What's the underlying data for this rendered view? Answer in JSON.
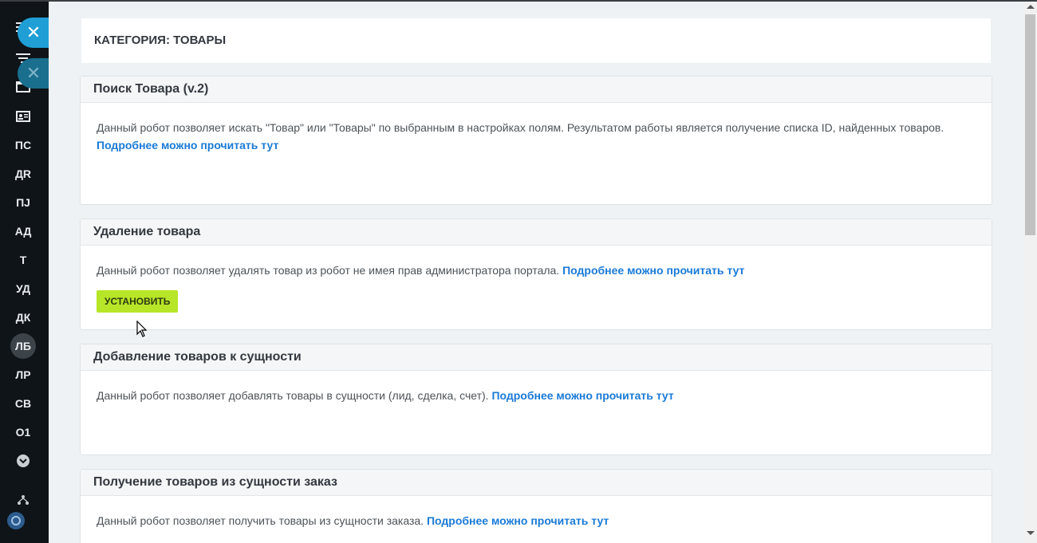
{
  "sidebar": {
    "items": [
      {
        "label": "ПС"
      },
      {
        "label": "ДR"
      },
      {
        "label": "ПJ"
      },
      {
        "label": "АД"
      },
      {
        "label": "Т"
      },
      {
        "label": "УД"
      },
      {
        "label": "ДК"
      },
      {
        "label": "ЛБ",
        "active": true
      },
      {
        "label": "ЛР"
      },
      {
        "label": "СВ"
      },
      {
        "label": "О1"
      }
    ],
    "close_glyph": "✕",
    "icons": [
      "menu-icon",
      "filter-icon",
      "calendar-icon",
      "contact-card-icon",
      "expand-down-icon",
      "org-structure-icon",
      "logo-icon"
    ],
    "colors": {
      "close_primary": "#1f9fd6",
      "close_secondary": "#1a6f8f"
    }
  },
  "category": {
    "title": "КАТЕГОРИЯ: ТОВАРЫ"
  },
  "cards": [
    {
      "title": "Поиск Товара (v.2)",
      "text": "Данный робот позволяет искать \"Товар\" или \"Товары\" по выбранным в настройках полям. Результатом работы является получение списка ID, найденных товаров.",
      "link": "Подробнее можно прочитать тут"
    },
    {
      "title": "Удаление товара",
      "text": "Данный робот позволяет удалять товар из робот не имея прав администратора портала.",
      "link": "Подробнее можно прочитать тут",
      "button": "УСТАНОВИТЬ"
    },
    {
      "title": "Добавление товаров к сущности",
      "text": "Данный робот позволяет добавлять товары в сущности (лид, сделка, счет).",
      "link": "Подробнее можно прочитать тут"
    },
    {
      "title": "Получение товаров из сущности заказ",
      "text": "Данный робот позволяет получить товары из сущности заказа.",
      "link": "Подробнее можно прочитать тут"
    }
  ],
  "colors": {
    "link": "#1a7ad6",
    "install_button": "#b7e528",
    "background": "#eef2f4"
  }
}
